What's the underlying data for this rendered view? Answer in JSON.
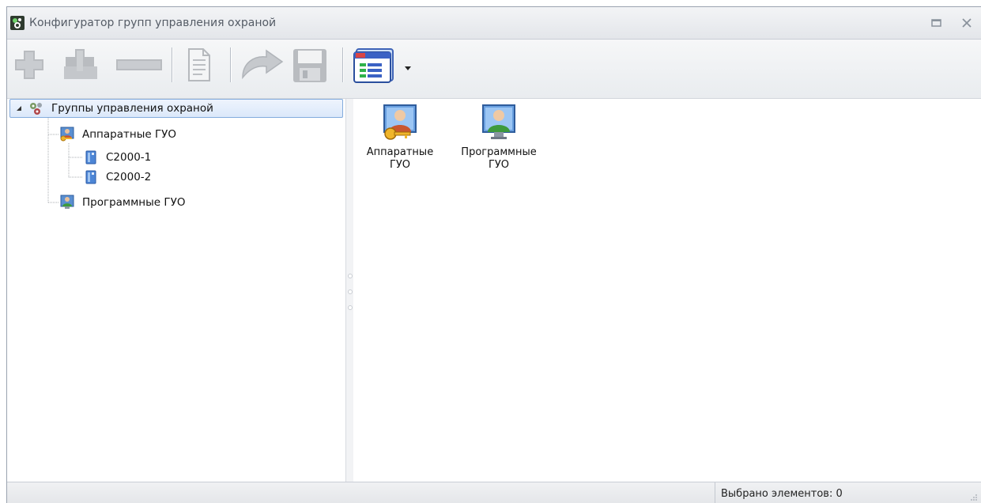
{
  "window": {
    "title": "Конфигуратор групп управления охраной"
  },
  "toolbar": {
    "buttons": [
      {
        "name": "add",
        "icon": "plus-icon"
      },
      {
        "name": "add-child",
        "icon": "plus-icon"
      },
      {
        "name": "remove",
        "icon": "minus-icon"
      },
      {
        "name": "properties",
        "icon": "document-icon"
      },
      {
        "name": "undo",
        "icon": "undo-icon"
      },
      {
        "name": "save",
        "icon": "floppy-icon"
      },
      {
        "name": "view",
        "icon": "view-list-icon"
      }
    ]
  },
  "tree": {
    "root": {
      "label": "Группы управления охраной",
      "icon": "gears-icon",
      "expanded": true,
      "selected": true
    },
    "items": [
      {
        "label": "Аппаратные ГУО",
        "icon": "user-key-icon"
      },
      {
        "label": "С2000-1",
        "icon": "device-icon"
      },
      {
        "label": "С2000-2",
        "icon": "device-icon"
      },
      {
        "label": "Программные ГУО",
        "icon": "user-monitor-icon"
      }
    ]
  },
  "content": {
    "items": [
      {
        "label": "Аппаратные ГУО",
        "icon": "user-key-icon"
      },
      {
        "label": "Программные ГУО",
        "icon": "user-monitor-icon"
      }
    ]
  },
  "status": {
    "selected_text": "Выбрано элементов: 0"
  },
  "colors": {
    "selection_border": "#84acdd",
    "selection_fill": "#dbe8fa",
    "toolbar_bg": "#e9ecef"
  }
}
